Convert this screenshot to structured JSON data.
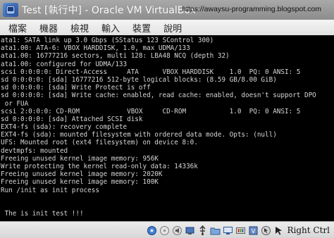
{
  "window": {
    "title": "Test [執行中] - Oracle VM VirtualBox",
    "watermark": "https://awaysu-programming.blogspot.com"
  },
  "menubar": {
    "items": [
      {
        "label": "檔案"
      },
      {
        "label": "機器"
      },
      {
        "label": "檢視"
      },
      {
        "label": "輸入"
      },
      {
        "label": "裝置"
      },
      {
        "label": "說明"
      }
    ]
  },
  "console": {
    "lines": [
      "ata1: SATA link up 3.0 Gbps (SStatus 123 SControl 300)",
      "ata1.00: ATA-6: VBOX HARDDISK, 1.0, max UDMA/133",
      "ata1.00: 16777216 sectors, multi 128: LBA48 NCQ (depth 32)",
      "ata1.00: configured for UDMA/133",
      "scsi 0:0:0:0: Direct-Access     ATA      VBOX HARDDISK    1.0  PQ: 0 ANSI: 5",
      "sd 0:0:0:0: [sda] 16777216 512-byte logical blocks: (8.59 GB/8.00 GiB)",
      "sd 0:0:0:0: [sda] Write Protect is off",
      "sd 0:0:0:0: [sda] Write cache: enabled, read cache: enabled, doesn't support DPO",
      " or FUA",
      "scsi 2:0:0:0: CD-ROM            VBOX     CD-ROM           1.0  PQ: 0 ANSI: 5",
      "sd 0:0:0:0: [sda] Attached SCSI disk",
      "EXT4-fs (sda): recovery complete",
      "EXT4-fs (sda): mounted filesystem with ordered data mode. Opts: (null)",
      "UFS: Mounted root (ext4 filesystem) on device 8:0.",
      "devtmpfs: mounted",
      "Freeing unused kernel image memory: 956K",
      "Write protecting the kernel read-only data: 14336k",
      "Freeing unused kernel image memory: 2020K",
      "Freeing unused kernel image memory: 100K",
      "Run /init as init process",
      "",
      "",
      " The is init test !!!",
      ""
    ]
  },
  "statusbar": {
    "icons": [
      "hard-disk-icon",
      "optical-drive-icon",
      "audio-icon",
      "network-icon",
      "usb-icon",
      "shared-folders-icon",
      "display-icon",
      "recording-icon",
      "virtualization-icon",
      "mouse-integration-icon",
      "keyboard-icon"
    ],
    "host_key_label": "Right Ctrl"
  },
  "colors": {
    "title_bar": "#9a9a9a",
    "console_bg": "#000000",
    "console_text": "#d6d6d6"
  }
}
